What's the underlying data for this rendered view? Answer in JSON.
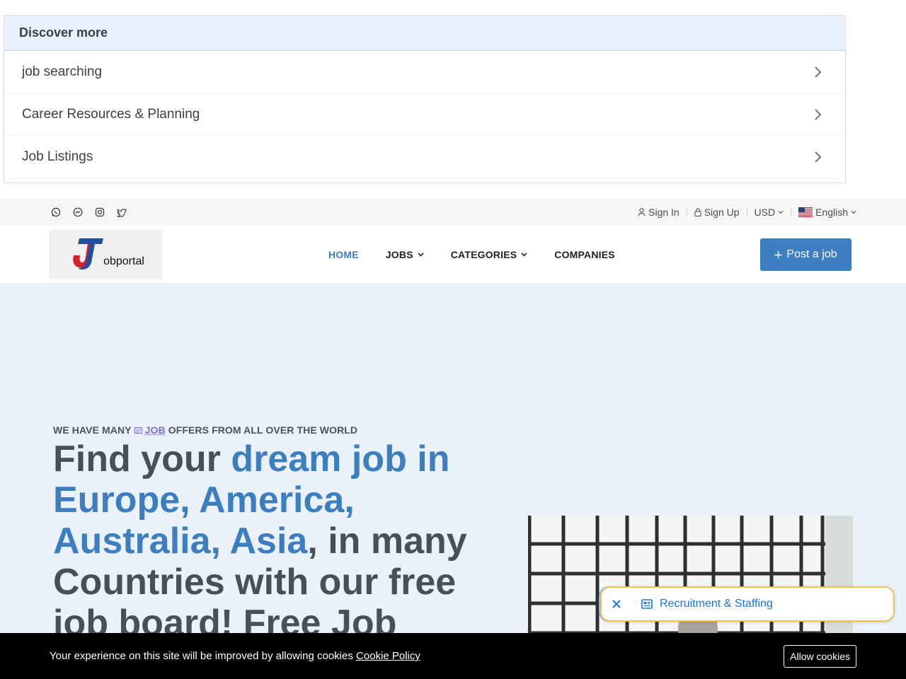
{
  "discover": {
    "title": "Discover more",
    "items": [
      {
        "label": "job searching"
      },
      {
        "label": "Career Resources & Planning"
      },
      {
        "label": "Job Listings"
      }
    ]
  },
  "topbar": {
    "socials": [
      "whatsapp-icon",
      "messenger-icon",
      "instagram-icon",
      "twitter-icon"
    ],
    "sign_in": "Sign In",
    "sign_up": "Sign Up",
    "currency": "USD",
    "language": "English"
  },
  "nav": {
    "logo_text": "obportal",
    "menu": [
      {
        "label": "HOME",
        "active": true
      },
      {
        "label": "JOBS"
      },
      {
        "label": "CATEGORIES"
      },
      {
        "label": "COMPANIES"
      }
    ],
    "post_button": "Post a job",
    "accent": "#3d7ec1"
  },
  "hero": {
    "tagline_pre": "WE HAVE MANY",
    "tagline_hl": "JOB",
    "tagline_post": "OFFERS FROM ALL OVER THE WORLD",
    "headline_part1": "Find your ",
    "headline_blue": "dream job in Europe, America, Australia, Asia",
    "headline_part2": ", in many Countries with our free job board! Free Job"
  },
  "pill": {
    "label": "Recruitment & Staffing"
  },
  "cookie": {
    "message": "Your experience on this site will be improved by allowing cookies",
    "link": "Cookie Policy",
    "button": "Allow cookies"
  }
}
